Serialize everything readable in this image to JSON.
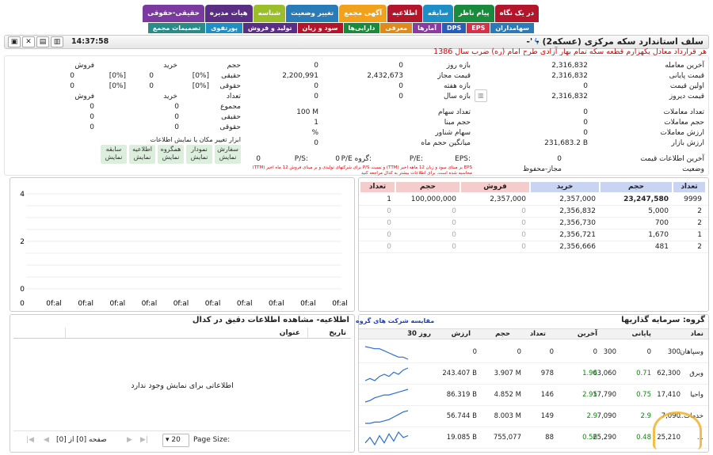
{
  "tabs_row1": [
    {
      "label": "در یک نگاه",
      "color": "#b3162b"
    },
    {
      "label": "پیام ناظر",
      "color": "#1a8b3c"
    },
    {
      "label": "سابقه",
      "color": "#1d8fc6"
    },
    {
      "label": "اطلاعیه",
      "color": "#b3162b"
    },
    {
      "label": "آگهی مجمع",
      "color": "#f2a11d"
    },
    {
      "label": "تغییر وضعیت",
      "color": "#2a7bb8"
    },
    {
      "label": "شناسه",
      "color": "#9bbf2a"
    },
    {
      "label": "هیات مدیره",
      "color": "#5b2e86"
    },
    {
      "label": "حقیقی-حقوقی",
      "color": "#7b3aa0"
    }
  ],
  "tabs_row2": [
    {
      "label": "سهامداران",
      "color": "#2a7bb8"
    },
    {
      "label": "EPS",
      "color": "#d6304a"
    },
    {
      "label": "DPS",
      "color": "#2a5db8"
    },
    {
      "label": "آمارها",
      "color": "#8a3aa0"
    },
    {
      "label": "معرفی",
      "color": "#e08a1d"
    },
    {
      "label": "دارایی‌ها",
      "color": "#1a8b3c"
    },
    {
      "label": "سود و زیان",
      "color": "#b3162b"
    },
    {
      "label": "تولید و فروش",
      "color": "#5b2e86"
    },
    {
      "label": "پورتفوی",
      "color": "#1d8fc6"
    },
    {
      "label": "تصمیمات مجمع",
      "color": "#2a8b8b"
    }
  ],
  "header": {
    "title": "سلف استاندارد سکه مرکزی (عسکه2) - '-",
    "clock": "14:37:58"
  },
  "subtitle": "هر قرارداد معادل یکهزارم قطعه سکه تمام بهار آزادی طرح امام (ره) ضرب سال 1386",
  "prices": {
    "l_last_trade": "آخرین معامله",
    "v_last_trade": "2,316,832",
    "l_final": "قیمت پایانی",
    "v_final": "2,316,832",
    "l_first": "اولین قیمت",
    "v_first": "0",
    "l_yesterday": "قیمت دیروز",
    "v_yesterday": "2,316,832"
  },
  "ranges": {
    "l_day": "بازه روز",
    "v_day_1": "0",
    "v_day_2": "0",
    "l_allowed": "قیمت مجاز",
    "v_allowed_1": "2,432,673",
    "v_allowed_2": "2,200,991",
    "l_week": "بازه هفته",
    "v_week_1": "0",
    "v_week_2": "0",
    "l_year": "بازه سال",
    "v_year_1": "0",
    "v_year_2": "0"
  },
  "trades": {
    "l_count": "تعداد معاملات",
    "v_count": "0",
    "l_volume": "حجم معاملات",
    "v_volume": "0",
    "l_value": "ارزش معاملات",
    "v_value": "0",
    "l_market": "ارزش بازار",
    "v_market": "231,683.2 B"
  },
  "shares": {
    "l_shares": "تعداد سهام",
    "v_shares": "100 M",
    "l_base": "حجم مبنا",
    "v_base": "1",
    "l_float": "سهام شناور",
    "v_float": "%",
    "l_avg": "میانگین حجم ماه",
    "v_avg": "0"
  },
  "status": {
    "l_last_info": "آخرین اطلاعات قیمت",
    "v_last_info": "0",
    "l_state": "وضعیت",
    "v_state": "مجاز-محفوظ"
  },
  "ratios": {
    "l_eps": "EPS:",
    "l_pe": "P/E:",
    "l_gpe": "P/E گروه:",
    "v_gpe": "0",
    "l_ps": "P/S:",
    "v_ps": "0",
    "note1": "EPS بر مبنای سود و زیان 12 ماهه اخیر (TTM) و نسبت P/S برای شرکتهای تولیدی و بر مبنای فروش 12 ماه اخیر (TTM)",
    "note2": "محاسبه شده است. برای اطلاعات بیشتر به کدال مراجعه کنید"
  },
  "client": {
    "h_volume": "حجم",
    "h_buy": "خرید",
    "h_sell": "فروش",
    "l_real": "حقیقی",
    "v_real_buy": "0",
    "v_real_buy_pct": "[0%]",
    "v_real_sell": "0",
    "v_real_sell_pct": "[0%]",
    "l_legal": "حقوقی",
    "v_legal_buy": "0",
    "v_legal_buy_pct": "[0%]",
    "v_legal_sell": "0",
    "v_legal_sell_pct": "[0%]",
    "h_count": "تعداد",
    "h_buy2": "خرید",
    "h_sell2": "فروش",
    "l_total": "مجموع",
    "v_total_buy": "0",
    "v_total_sell": "0",
    "l_real2": "حقیقی",
    "v_real2_buy": "0",
    "v_real2_sell": "0",
    "l_legal2": "حقوقی",
    "v_legal2_buy": "0",
    "v_legal2_sell": "0"
  },
  "tools": {
    "label": "ابزار تغییر مکان یا نمایش اطلاعات",
    "buttons": [
      {
        "l1": "سفارش",
        "l2": "نمایش"
      },
      {
        "l1": "نمودار",
        "l2": "نمایش"
      },
      {
        "l1": "همگروه",
        "l2": "نمایش"
      },
      {
        "l1": "اطلاعیه",
        "l2": "نمایش"
      },
      {
        "l1": "سابقه",
        "l2": "نمایش"
      }
    ]
  },
  "chart_data": {
    "type": "line",
    "y_ticks": [
      "4",
      "2",
      "0"
    ],
    "ylim": [
      0,
      4
    ],
    "x_ticks": [
      "0",
      "0f:al",
      "0f:al",
      "0f:al",
      "0f:al",
      "0f:al",
      "0f:al",
      "0f:al",
      "0f:al",
      "0f:al",
      "0f:al"
    ],
    "x": [],
    "values": []
  },
  "orderbook": {
    "headers": [
      "تعداد",
      "حجم",
      "خرید",
      "فروش",
      "حجم",
      "تعداد"
    ],
    "header_colors": [
      "#c9d3f2",
      "#c9d3f2",
      "#c9d3f2",
      "#f5cccc",
      "#f5cccc",
      "#f5cccc"
    ],
    "rows": [
      [
        "9999",
        "23,247,580",
        "2,357,000",
        "2,357,000",
        "100,000,000",
        "1"
      ],
      [
        "2",
        "5,000",
        "2,356,832",
        "0",
        "0",
        "0"
      ],
      [
        "2",
        "700",
        "2,356,730",
        "0",
        "0",
        "0"
      ],
      [
        "1",
        "1,670",
        "2,356,721",
        "0",
        "0",
        "0"
      ],
      [
        "2",
        "481",
        "2,356,666",
        "0",
        "0",
        "0"
      ]
    ]
  },
  "news": {
    "title": "اطلاعیه- مشاهده اطلاعات دقیق در کدال",
    "col_date": "تاریخ",
    "col_title": "عنوان",
    "empty": "اطلاعاتی برای نمایش وجود ندارد",
    "page_size_label": "Page Size:",
    "page_size": "20",
    "pager": "صفحه [0] از [0]"
  },
  "group": {
    "title": "گروه: سرمایه گذاریها",
    "compare_link": "مقایسه شرکت های گروه",
    "headers": [
      "نماد",
      "پایانی",
      "آخرین",
      "تعداد",
      "حجم",
      "ارزش",
      "30 روز"
    ],
    "rows": [
      {
        "name": "وسپاهان",
        "final": "300",
        "fchg": "0",
        "last": "300",
        "lchg": "0",
        "count": "0",
        "volume": "0",
        "value": "0",
        "spark": [
          16,
          15,
          14,
          14,
          12,
          10,
          8,
          6,
          6,
          4
        ]
      },
      {
        "name": "وبرق",
        "final": "62,300",
        "fchg": "0.71",
        "last": "63,060",
        "lchg": "1.94",
        "count": "978",
        "volume": "3.907 M",
        "value": "243.407 B",
        "spark": [
          6,
          7,
          6,
          8,
          9,
          8,
          10,
          9,
          11,
          12
        ]
      },
      {
        "name": "واحیا",
        "final": "17,410",
        "fchg": "0.75",
        "last": "17,790",
        "lchg": "2.95",
        "count": "146",
        "volume": "4.852 M",
        "value": "86.319 B",
        "spark": [
          4,
          5,
          7,
          8,
          9,
          9,
          10,
          11,
          12,
          13
        ]
      },
      {
        "name": "...خدمات",
        "final": "7,090",
        "fchg": "2.9",
        "last": "7,090",
        "lchg": "2.9",
        "count": "149",
        "volume": "8.003 M",
        "value": "56.744 B",
        "spark": [
          4,
          4,
          5,
          5,
          6,
          7,
          9,
          11,
          13,
          14
        ]
      },
      {
        "name": "...",
        "final": "25,210",
        "fchg": "0.48",
        "last": "25,290",
        "lchg": "0.56",
        "count": "88",
        "volume": "755,077",
        "value": "19.085 B",
        "spark": [
          6,
          9,
          5,
          10,
          6,
          11,
          7,
          12,
          9,
          10
        ]
      }
    ]
  }
}
